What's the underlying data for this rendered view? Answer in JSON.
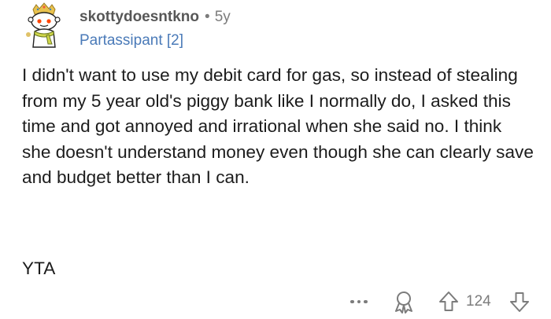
{
  "comment": {
    "author": "skottydoesntkno",
    "separator": "•",
    "age": "5y",
    "flair": "Partassipant [2]",
    "body": "I didn't want to use my debit card for gas, so instead of stealing from my 5 year old's piggy bank like I normally do, I asked this time and got annoyed and irrational when she said no. I think she doesn't understand money even though she can clearly save and budget better than I can.",
    "verdict": "YTA"
  },
  "actions": {
    "more_icon": "more-dots-icon",
    "award_icon": "award-ribbon-icon",
    "upvote_icon": "upvote-arrow-icon",
    "score": "124",
    "downvote_icon": "downvote-arrow-icon"
  },
  "colors": {
    "text": "#1c1c1c",
    "username": "#575757",
    "muted": "#7c7c7c",
    "flair": "#4a7ab8",
    "avatar_accent": "#d8b343"
  }
}
